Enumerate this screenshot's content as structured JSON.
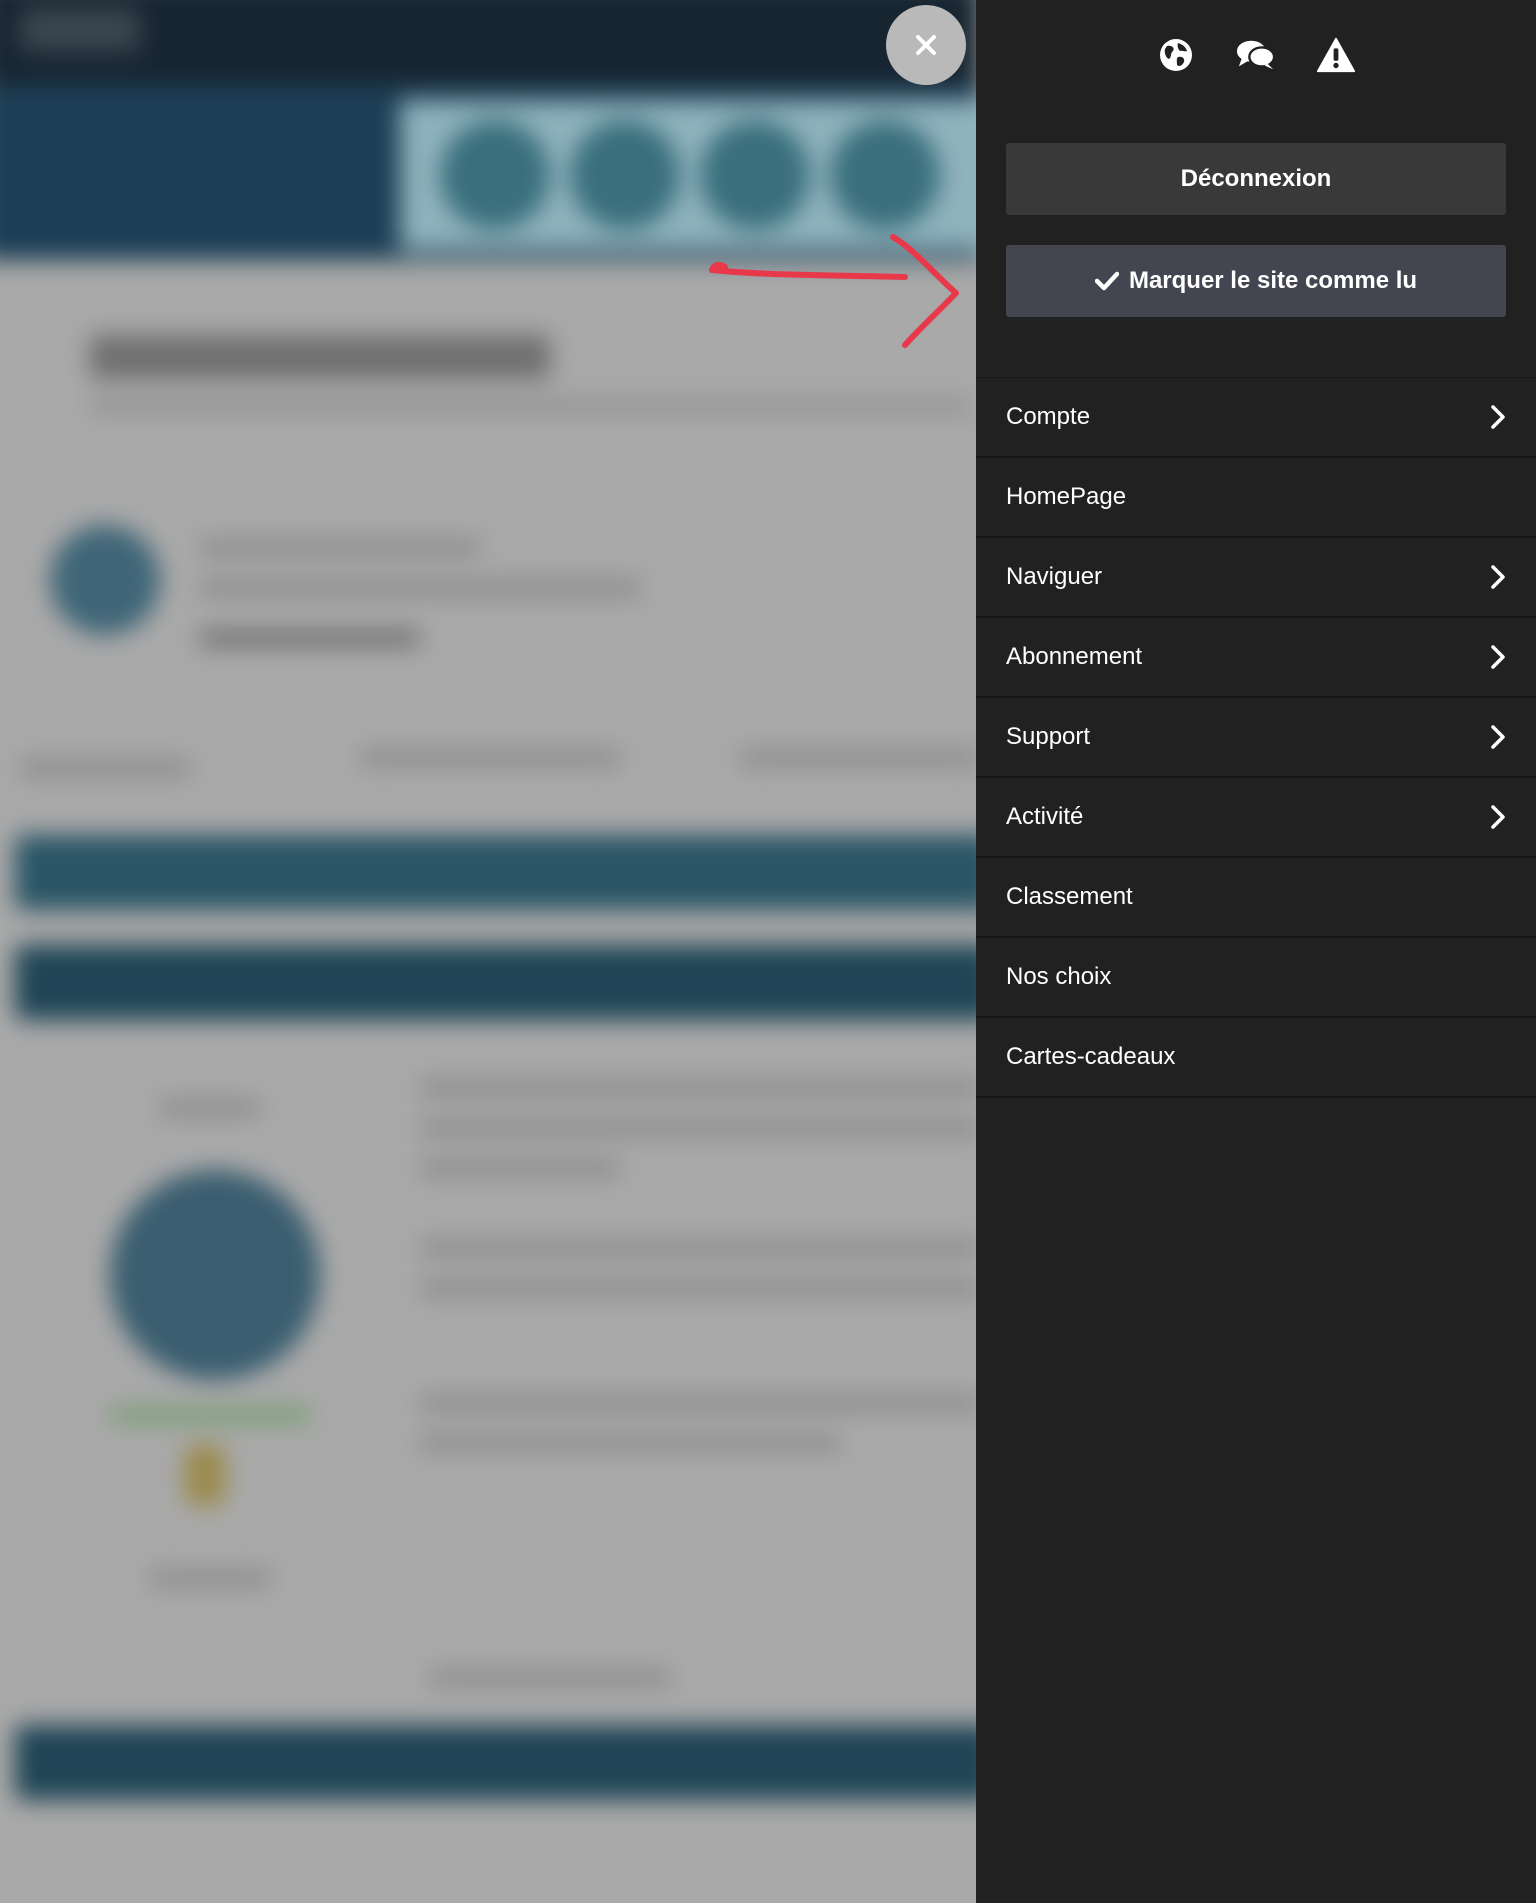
{
  "overlay": {
    "close_label": "×"
  },
  "drawer": {
    "icons": [
      "globe-icon",
      "comments-icon",
      "warning-icon"
    ],
    "logout_label": "Déconnexion",
    "mark_read_label": "Marquer le site comme lu",
    "menu": [
      {
        "label": "Compte",
        "has_submenu": true
      },
      {
        "label": "HomePage",
        "has_submenu": false
      },
      {
        "label": "Naviguer",
        "has_submenu": true
      },
      {
        "label": "Abonnement",
        "has_submenu": true
      },
      {
        "label": "Support",
        "has_submenu": true
      },
      {
        "label": "Activité",
        "has_submenu": true
      },
      {
        "label": "Classement",
        "has_submenu": false
      },
      {
        "label": "Nos choix",
        "has_submenu": false
      },
      {
        "label": "Cartes-cadeaux",
        "has_submenu": false
      }
    ]
  },
  "colors": {
    "drawer_bg": "#212121",
    "logout_bg": "#393939",
    "mark_read_bg": "#434650",
    "annotation": "#e8394a"
  }
}
